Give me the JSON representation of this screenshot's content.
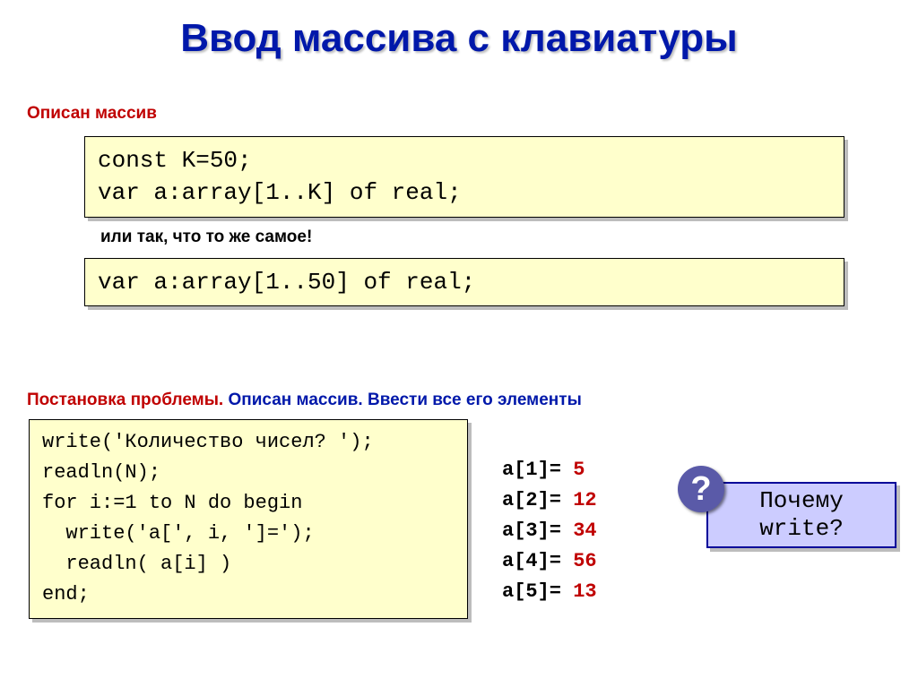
{
  "title": "Ввод массива с клавиатуры",
  "labels": {
    "described": "Описан массив",
    "or_same": "или так, что то же самое!",
    "problem_prefix": "Постановка проблемы.",
    "problem_rest": " Описан массив. Ввести все его элементы"
  },
  "code1": {
    "line1": "const K=50;",
    "line2": "var a:array[1..K] of real;"
  },
  "code2": {
    "line1": "var a:array[1..50] of real;"
  },
  "code3": {
    "line1": "write('Количество чисел? ');",
    "line2": "readln(N);",
    "line3": "for i:=1 to N do begin",
    "line4": "  write('a[', i, ']=');",
    "line5": "  readln( a[i] )",
    "line6": "end;"
  },
  "output": [
    {
      "label": "a[1]=",
      "value": "5"
    },
    {
      "label": "a[2]=",
      "value": "12"
    },
    {
      "label": "a[3]=",
      "value": "34"
    },
    {
      "label": "a[4]=",
      "value": "56"
    },
    {
      "label": "a[5]=",
      "value": "13"
    }
  ],
  "callout": {
    "line1": "Почему",
    "line2": "write?",
    "question_mark": "?"
  }
}
